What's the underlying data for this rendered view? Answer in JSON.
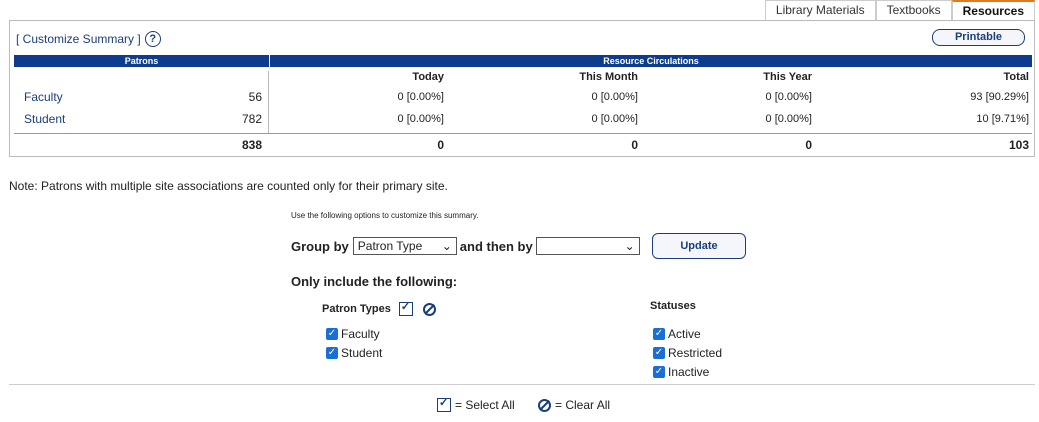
{
  "tabs": [
    {
      "label": "Library Materials",
      "active": false
    },
    {
      "label": "Textbooks",
      "active": false
    },
    {
      "label": "Resources",
      "active": true
    }
  ],
  "summary": {
    "customize_label": "[ Customize Summary ]",
    "help": "?",
    "printable": "Printable",
    "patrons_header": "Patrons",
    "circulations_header": "Resource Circulations",
    "columns": [
      "Today",
      "This Month",
      "This Year",
      "Total"
    ],
    "rows": [
      {
        "label": "Faculty",
        "count": "56",
        "today": "0 [0.00%]",
        "month": "0 [0.00%]",
        "year": "0 [0.00%]",
        "total": "93 [90.29%]"
      },
      {
        "label": "Student",
        "count": "782",
        "today": "0 [0.00%]",
        "month": "0 [0.00%]",
        "year": "0 [0.00%]",
        "total": "10 [9.71%]"
      }
    ],
    "totals": {
      "count": "838",
      "today": "0",
      "month": "0",
      "year": "0",
      "total": "103"
    }
  },
  "note": "Note: Patrons with multiple site associations are counted only for their primary site.",
  "options": {
    "hint": "Use the following options to customize this summary.",
    "group_by_label": "Group by",
    "group_by_value": "Patron Type",
    "then_by_label": "and then by",
    "then_by_value": "",
    "update_label": "Update",
    "only_include": "Only include the following:",
    "patron_types_label": "Patron Types",
    "patron_types": [
      "Faculty",
      "Student"
    ],
    "statuses_label": "Statuses",
    "statuses": [
      "Active",
      "Restricted",
      "Inactive"
    ]
  },
  "legend": {
    "select_all": "= Select All",
    "clear_all": "= Clear All"
  },
  "colors": {
    "header_blue": "#0d3b8e",
    "link_blue": "#1a3e7c",
    "tab_accent": "#e07a1f",
    "checkbox_blue": "#1a6fd6"
  }
}
